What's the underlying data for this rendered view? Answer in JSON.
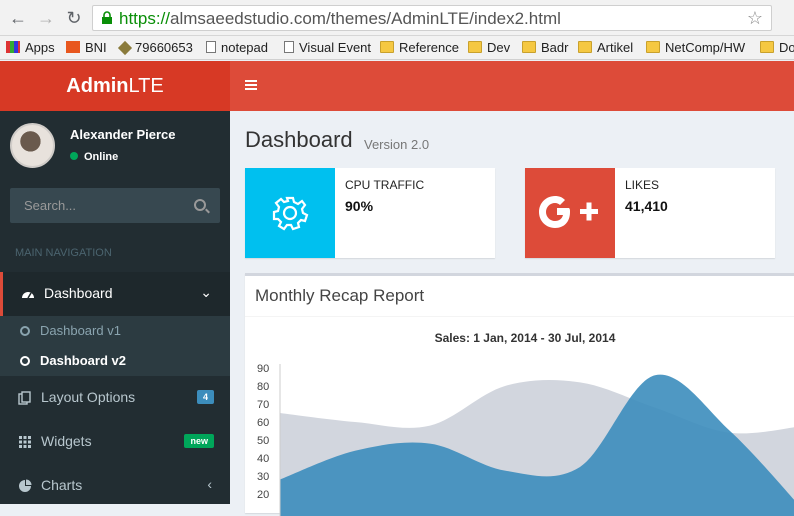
{
  "browser": {
    "url_scheme": "https://",
    "url_rest": "almsaeedstudio.com/themes/AdminLTE/index2.html",
    "bookmarks": [
      {
        "label": "Apps",
        "icon": "apps-icon"
      },
      {
        "label": "BNI",
        "icon": "bni-icon"
      },
      {
        "label": "79660653",
        "icon": "diamond-icon"
      },
      {
        "label": "notepad",
        "icon": "page-icon"
      },
      {
        "label": "Visual Event",
        "icon": "page-icon"
      },
      {
        "label": "Reference",
        "icon": "folder-icon"
      },
      {
        "label": "Dev",
        "icon": "folder-icon"
      },
      {
        "label": "Badr",
        "icon": "folder-icon"
      },
      {
        "label": "Artikel",
        "icon": "folder-icon"
      },
      {
        "label": "NetComp/HW",
        "icon": "folder-icon"
      },
      {
        "label": "Dov",
        "icon": "folder-icon"
      }
    ]
  },
  "logo": {
    "bold": "Admin",
    "light": "LTE"
  },
  "user": {
    "name": "Alexander Pierce",
    "status": "Online"
  },
  "search": {
    "placeholder": "Search..."
  },
  "nav_header": "MAIN NAVIGATION",
  "menu": {
    "dashboard": "Dashboard",
    "sub": [
      "Dashboard v1",
      "Dashboard v2"
    ],
    "layout": {
      "label": "Layout Options",
      "badge": "4"
    },
    "widgets": {
      "label": "Widgets",
      "badge": "new"
    },
    "charts": "Charts"
  },
  "page": {
    "title": "Dashboard",
    "subtitle": "Version 2.0"
  },
  "info_boxes": [
    {
      "label": "CPU TRAFFIC",
      "value": "90%",
      "icon": "gear-icon",
      "color": "#00c0ef"
    },
    {
      "label": "LIKES",
      "value": "41,410",
      "icon": "google-plus-icon",
      "color": "#dd4b39"
    }
  ],
  "report": {
    "title": "Monthly Recap Report",
    "chart_title": "Sales: 1 Jan, 2014 - 30 Jul, 2014"
  },
  "colors": {
    "header": "#dd4b39",
    "logo": "#d73925",
    "sidebar": "#222d32",
    "area_gray": "#d2d6de",
    "area_blue": "#3c8dbc",
    "badge_blue": "#3c8dbc",
    "badge_green": "#00a65a"
  },
  "chart_data": {
    "type": "area",
    "title": "Sales: 1 Jan, 2014 - 30 Jul, 2014",
    "yticks": [
      "90",
      "80",
      "70",
      "60",
      "50",
      "40",
      "30",
      "20"
    ],
    "ylim": [
      20,
      90
    ],
    "grid": false,
    "series": [
      {
        "name": "",
        "values": [
          65,
          60,
          58,
          80,
          82,
          68,
          54,
          58
        ]
      },
      {
        "name": "",
        "values": [
          28,
          44,
          48,
          33,
          35,
          86,
          55,
          10
        ]
      }
    ]
  }
}
